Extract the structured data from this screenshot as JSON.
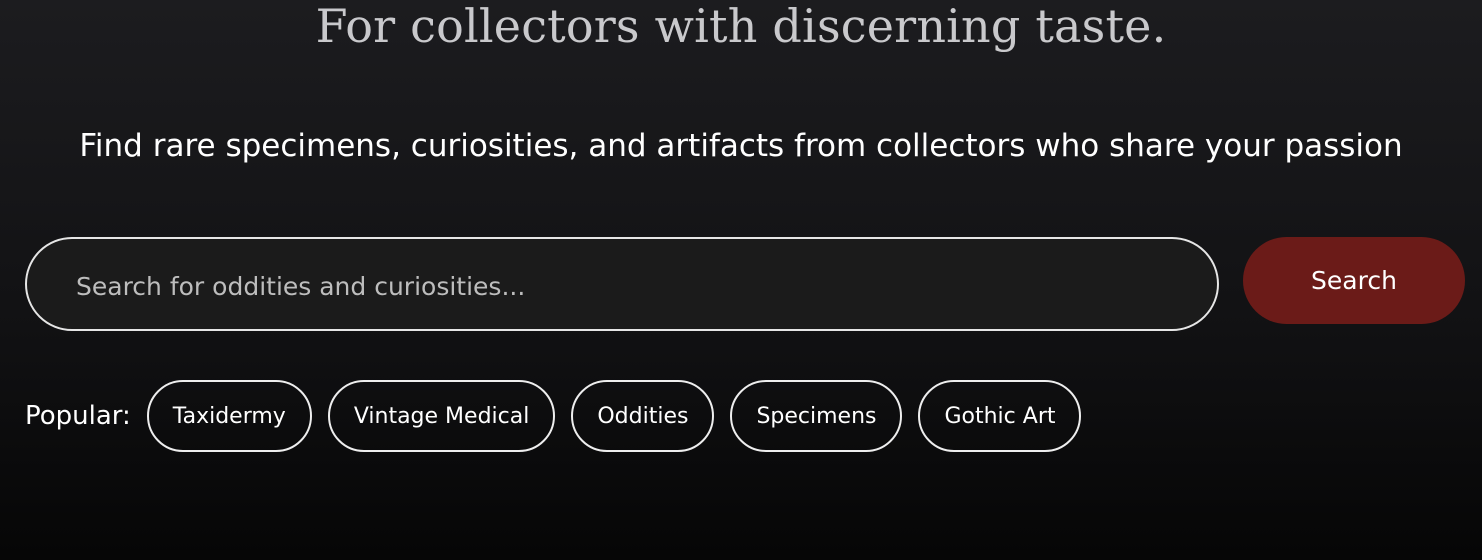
{
  "hero": {
    "tagline": "For collectors with discerning taste.",
    "subtitle": "Find rare specimens, curiosities, and artifacts from collectors who share your passion"
  },
  "search": {
    "placeholder": "Search for oddities and curiosities...",
    "value": "",
    "button_label": "Search"
  },
  "popular": {
    "label": "Popular:",
    "tags": [
      "Taxidermy",
      "Vintage Medical",
      "Oddities",
      "Specimens",
      "Gothic Art"
    ]
  },
  "colors": {
    "accent": "#6b1b18",
    "background_top": "#1c1c1f",
    "background_bottom": "#060606",
    "tagline": "#c9c9cc",
    "border": "#e6e6e6"
  }
}
